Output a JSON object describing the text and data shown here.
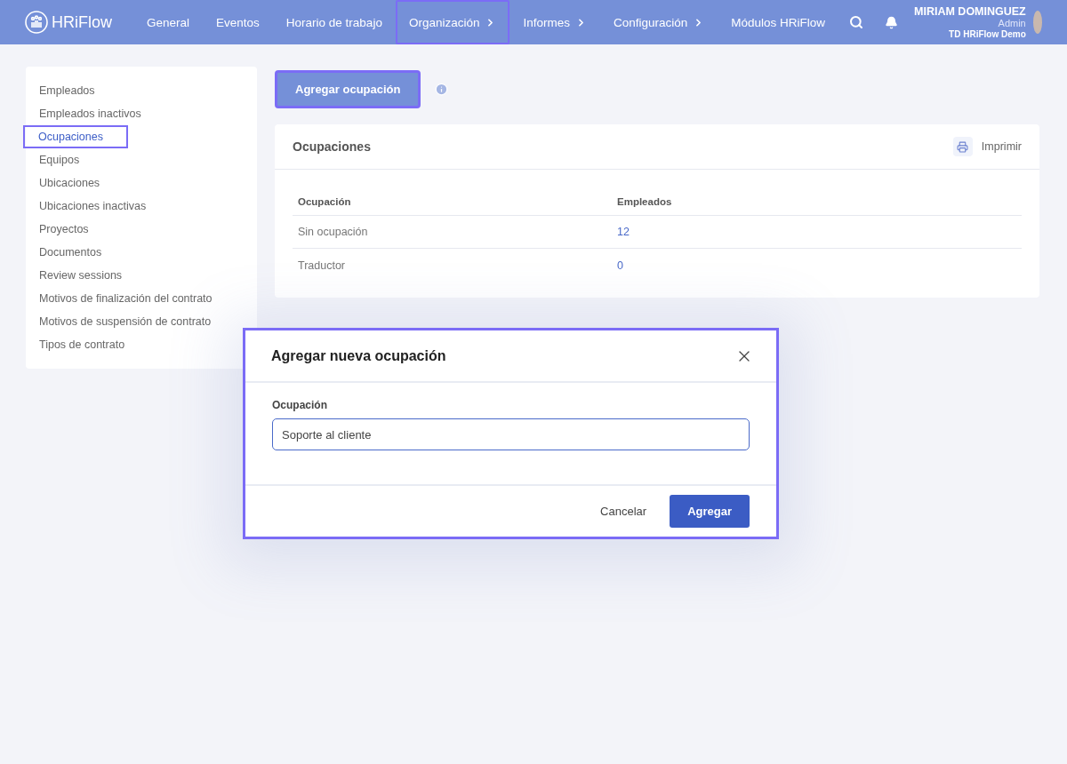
{
  "brand": {
    "name": "HRiFlow"
  },
  "nav": [
    {
      "label": "General",
      "submenu": false,
      "selected": false
    },
    {
      "label": "Eventos",
      "submenu": false,
      "selected": false
    },
    {
      "label": "Horario de trabajo",
      "submenu": false,
      "selected": false
    },
    {
      "label": "Organización",
      "submenu": true,
      "selected": true
    },
    {
      "label": "Informes",
      "submenu": true,
      "selected": false
    },
    {
      "label": "Configuración",
      "submenu": true,
      "selected": false
    },
    {
      "label": "Módulos HRiFlow",
      "submenu": false,
      "selected": false
    }
  ],
  "user": {
    "name": "MIRIAM DOMINGUEZ",
    "role": "Admin",
    "company": "TD HRiFlow Demo"
  },
  "sidebar": {
    "items": [
      {
        "label": "Empleados",
        "selected": false
      },
      {
        "label": "Empleados inactivos",
        "selected": false
      },
      {
        "label": "Ocupaciones",
        "selected": true
      },
      {
        "label": "Equipos",
        "selected": false
      },
      {
        "label": "Ubicaciones",
        "selected": false
      },
      {
        "label": "Ubicaciones inactivas",
        "selected": false
      },
      {
        "label": "Proyectos",
        "selected": false
      },
      {
        "label": "Documentos",
        "selected": false
      },
      {
        "label": "Review sessions",
        "selected": false
      },
      {
        "label": "Motivos de finalización del contrato",
        "selected": false
      },
      {
        "label": "Motivos de suspensión de contrato",
        "selected": false
      },
      {
        "label": "Tipos de contrato",
        "selected": false
      }
    ]
  },
  "add_button": {
    "label": "Agregar ocupación",
    "highlighted": true
  },
  "card": {
    "title": "Ocupaciones",
    "print_label": "Imprimir"
  },
  "table": {
    "columns": [
      "Ocupación",
      "Empleados"
    ],
    "rows": [
      [
        "Sin ocupación",
        "12"
      ],
      [
        "Traductor",
        "0"
      ]
    ]
  },
  "dialog": {
    "title": "Agregar nueva ocupación",
    "field_label": "Ocupación",
    "field_value": "Soporte al cliente",
    "cancel": "Cancelar",
    "confirm": "Agregar"
  }
}
